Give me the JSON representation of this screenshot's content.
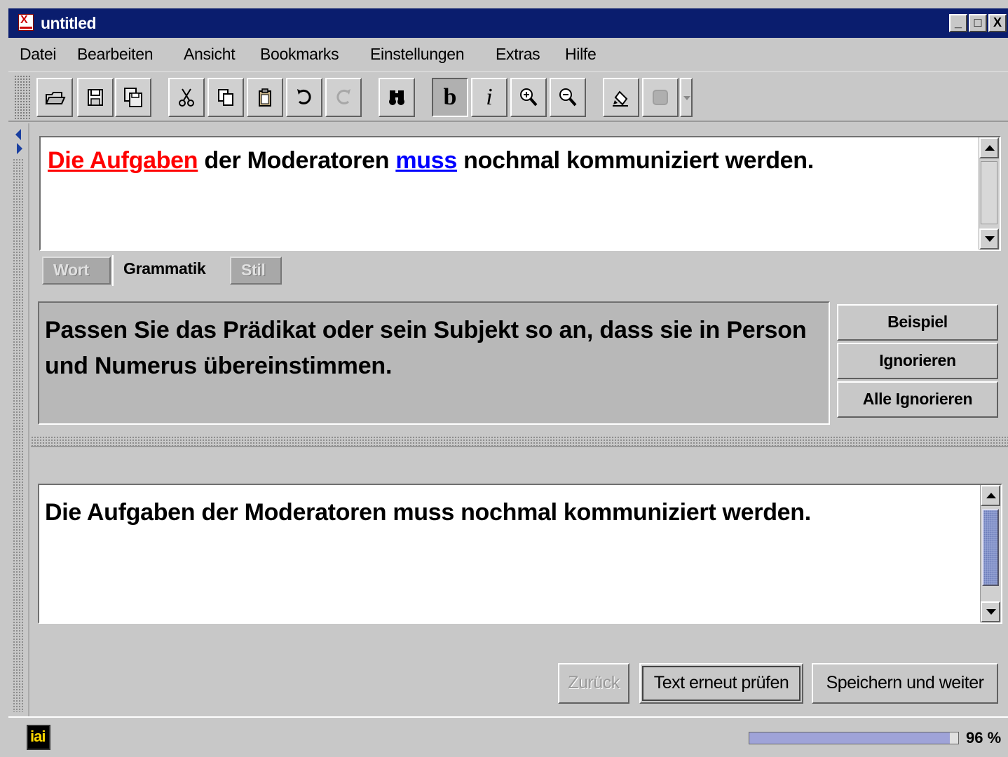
{
  "window": {
    "title": "untitled",
    "controls": {
      "minimize": "_",
      "maximize": "□",
      "close": "X"
    }
  },
  "menubar": {
    "items": [
      "Datei",
      "Bearbeiten",
      "Ansicht",
      "Bookmarks",
      "Einstellungen",
      "Extras",
      "Hilfe"
    ]
  },
  "toolbar": {
    "bold_label": "b",
    "italic_label": "i",
    "icons": [
      "open-icon",
      "save-icon",
      "save-all-icon",
      "cut-icon",
      "copy-icon",
      "paste-icon",
      "undo-icon",
      "redo-icon",
      "find-icon",
      "bold-icon",
      "italic-icon",
      "zoom-in-icon",
      "zoom-out-icon",
      "check-icon",
      "stop-icon"
    ]
  },
  "editor_top": {
    "error1": "Die Aufgaben",
    "text1": " der Moderatoren ",
    "error2": "muss",
    "text2": " nochmal kommuniziert werden."
  },
  "tabs": [
    {
      "label": "Wort",
      "state": "disabled"
    },
    {
      "label": "Grammatik",
      "state": "selected"
    },
    {
      "label": "Stil",
      "state": "disabled"
    }
  ],
  "message": {
    "text": "Passen Sie das Prädikat oder sein Subjekt so an, dass sie in Person und Numerus übereinstimmen."
  },
  "side_buttons": {
    "example": "Beispiel",
    "ignore": "Ignorieren",
    "ignore_all": "Alle Ignorieren"
  },
  "editor_bottom": {
    "text": "Die Aufgaben der Moderatoren muss nochmal kommuniziert werden."
  },
  "bottom_buttons": {
    "back": "Zurück",
    "recheck": "Text erneut prüfen",
    "save_next": "Speichern und weiter"
  },
  "status": {
    "logo_text": "iai",
    "progress_fraction": 0.96,
    "progress_label": "96 %"
  },
  "colors": {
    "titlebar": "#0a1d6e",
    "error_red": "#ff0000",
    "error_blue": "#0000ff",
    "progress_fill": "#9fa3d8"
  }
}
